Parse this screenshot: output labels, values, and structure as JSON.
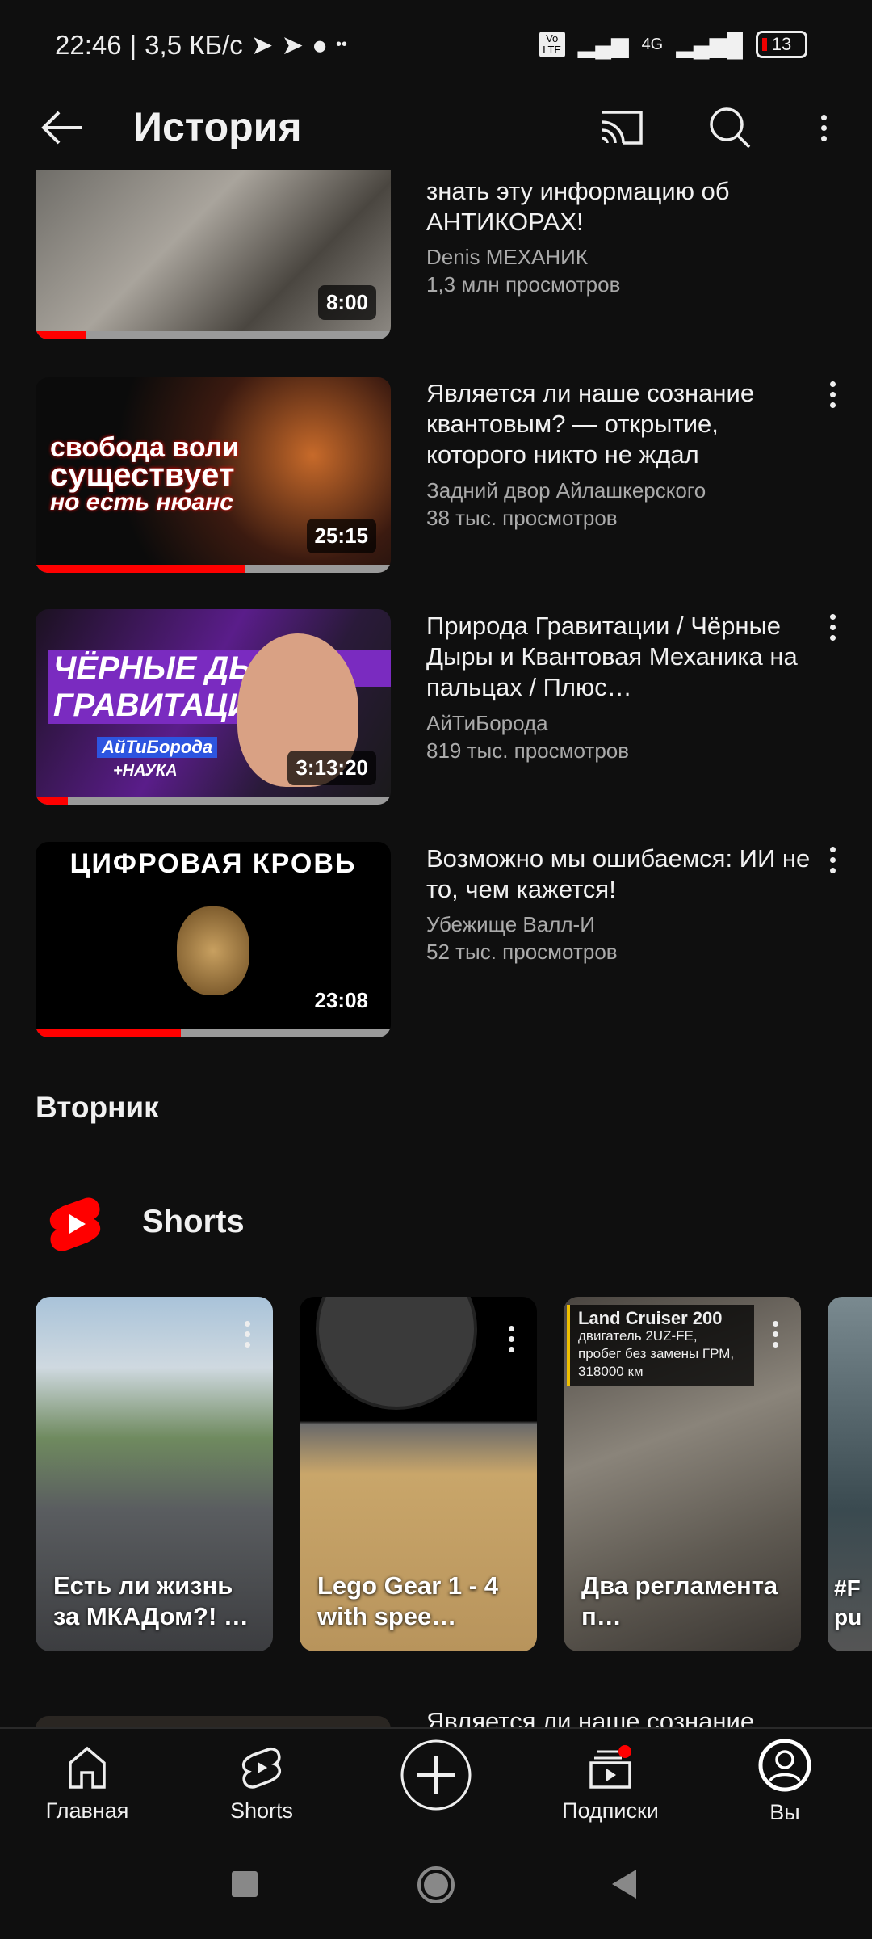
{
  "status_bar": {
    "time": "22:46",
    "speed": "3,5 КБ/с",
    "network": "4G",
    "volte": "Vo LTE",
    "battery": "13"
  },
  "header": {
    "title": "История",
    "icons": [
      "back-arrow-icon",
      "cast-icon",
      "search-icon",
      "more-vert-icon"
    ]
  },
  "videos": [
    {
      "title": "знать эту информацию об АНТИКОРАХ!",
      "channel": "Denis МЕХАНИК",
      "views": "1,3 млн просмотров",
      "duration": "8:00",
      "progress": 0.14
    },
    {
      "title": "Является ли наше сознание квантовым? — открытие, которого никто не ждал",
      "channel": "Задний двор Айлашкерского",
      "views": "38 тыс. просмотров",
      "duration": "25:15",
      "progress": 0.59,
      "thumb_text": [
        "свобода воли",
        "существует",
        "но есть нюанс"
      ]
    },
    {
      "title": "Природа Гравитации / Чёрные Дыры и Квантовая Механика на пальцах / Плюс…",
      "channel": "АйТиБорода",
      "views": "819 тыс. просмотров",
      "duration": "3:13:20",
      "progress": 0.09,
      "thumb_text": [
        "ЧЁРНЫЕ ДЫРЫ",
        "ГРАВИТАЦИЯ",
        "АйТиБорода",
        "+НАУКА"
      ]
    },
    {
      "title": "Возможно мы ошибаемся: ИИ не то, чем кажется!",
      "channel": "Убежище Валл-И",
      "views": "52 тыс. просмотров",
      "duration": "23:08",
      "progress": 0.41,
      "thumb_text": [
        "ЦИФРОВАЯ КРОВЬ"
      ]
    }
  ],
  "section": {
    "day": "Вторник",
    "shorts_label": "Shorts"
  },
  "shorts": [
    {
      "title": "Есть ли жизнь за МКАДом?! …"
    },
    {
      "title": "Lego Gear 1 - 4 with spee…"
    },
    {
      "title": "Два регламента п…",
      "overlay": [
        "Land Cruiser 200",
        "двигатель 2UZ-FE,",
        "пробег без замены ГРМ,",
        "318000 км"
      ]
    },
    {
      "title": "#F pu"
    }
  ],
  "partial_next": {
    "title": "Является ли наше сознание"
  },
  "nav": {
    "items": [
      {
        "label": "Главная"
      },
      {
        "label": "Shorts"
      },
      {
        "label": ""
      },
      {
        "label": "Подписки"
      },
      {
        "label": "Вы"
      }
    ]
  },
  "colors": {
    "accent": "#ff0000",
    "background": "#0f0f0f"
  }
}
